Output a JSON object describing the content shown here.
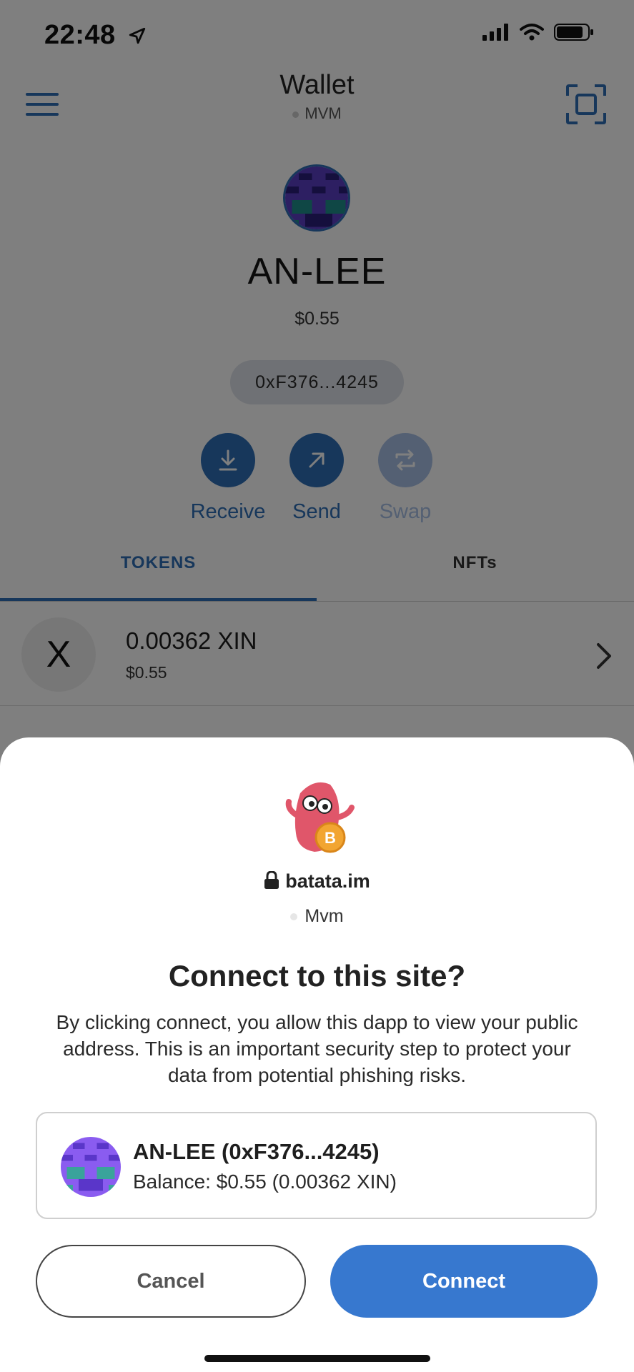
{
  "status_bar": {
    "time": "22:48"
  },
  "wallet": {
    "title": "Wallet",
    "network": "MVM",
    "account_name": "AN-LEE",
    "balance": "$0.55",
    "address": "0xF376...4245",
    "actions": [
      {
        "label": "Receive"
      },
      {
        "label": "Send"
      },
      {
        "label": "Swap"
      }
    ],
    "tabs": [
      {
        "label": "TOKENS"
      },
      {
        "label": "NFTs"
      }
    ],
    "tokens": [
      {
        "icon_letter": "X",
        "amount": "0.00362 XIN",
        "usd": "$0.55"
      }
    ]
  },
  "connect_sheet": {
    "site": "batata.im",
    "network": "Mvm",
    "title": "Connect to this site?",
    "description": "By clicking connect, you allow this dapp to view your public address. This is an important security step to protect your data from potential phishing risks.",
    "account_line": "AN-LEE (0xF376...4245)",
    "balance_line": "Balance: $0.55 (0.00362 XIN)",
    "cancel_label": "Cancel",
    "connect_label": "Connect"
  },
  "colors": {
    "accent": "#3778cf",
    "link_blue": "#2f6fb6",
    "overlay": "rgba(0,0,0,0.5)"
  },
  "icons": [
    "location-arrow-icon",
    "signal-icon",
    "wifi-icon",
    "battery-icon",
    "hamburger-icon",
    "scan-icon",
    "receive-icon",
    "send-icon",
    "swap-icon",
    "chevron-right-icon",
    "lock-icon"
  ]
}
